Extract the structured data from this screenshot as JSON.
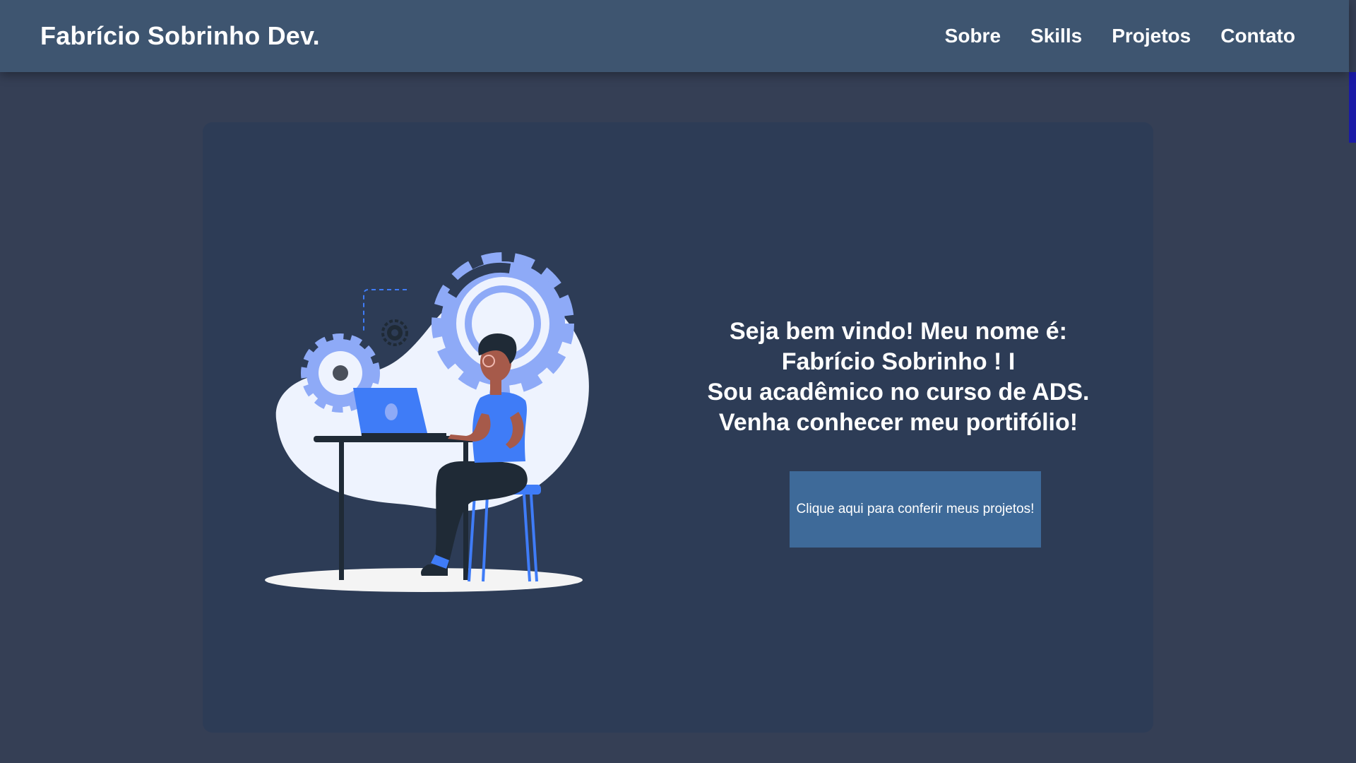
{
  "header": {
    "brand": "Fabrício Sobrinho Dev.",
    "nav": [
      {
        "label": "Sobre"
      },
      {
        "label": "Skills"
      },
      {
        "label": "Projetos"
      },
      {
        "label": "Contato"
      }
    ]
  },
  "hero": {
    "lines": [
      "Seja bem vindo! Meu nome é:",
      "Fabrício Sobrinho ! I",
      "Sou acadêmico no curso de ADS.",
      "Venha conhecer meu portifólio!"
    ],
    "cta_label": "Clique aqui para conferir meus projetos!"
  },
  "colors": {
    "background": "#353f55",
    "navbar": "#3e5570",
    "card": "#2d3c56",
    "button": "#3e6a99",
    "accent_blue": "#3f7cf7",
    "gear_light": "#8eaaf7",
    "scrollbar_thumb": "#1a1aa6"
  },
  "icons": {
    "illustration": "developer-at-laptop-with-gears-illustration"
  }
}
